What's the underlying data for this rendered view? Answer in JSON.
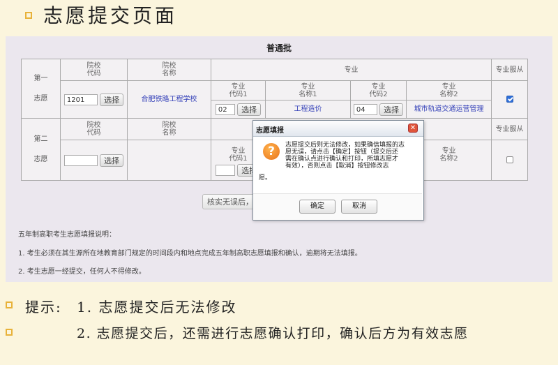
{
  "slide": {
    "title": "志愿提交页面",
    "tip_label": "提示:",
    "tip_1": "1. 志愿提交后无法修改",
    "tip_2": "2. 志愿提交后，还需进行志愿确认打印，确认后方为有效志愿"
  },
  "form": {
    "batch_title": "普通批",
    "choice1": {
      "label_top": "第一",
      "label_bottom": "志愿",
      "school_code_header": "院校\n代码",
      "school_name_header": "院校\n名称",
      "major_header": "专业",
      "obey_header": "专业服从",
      "school_code_value": "1201",
      "select_label": "选择",
      "school_name": "合肥铁路工程学校",
      "major1_code_header": "专业\n代码1",
      "major1_name_header": "专业\n名称1",
      "major2_code_header": "专业\n代码2",
      "major2_name_header": "专业\n名称2",
      "major1_code_value": "02",
      "major1_name": "工程造价",
      "major2_code_value": "04",
      "major2_name": "城市轨道交通运营管理",
      "obey_checked": true
    },
    "choice2": {
      "label_top": "第二",
      "label_bottom": "志愿",
      "school_code_header": "院校\n代码",
      "school_name_header": "院校\n名称",
      "obey_header": "专业服从",
      "select_label": "选择",
      "major1_code_header": "专业\n代码1",
      "major2_name_header": "专业\n名称2",
      "major_select_label": "选择",
      "obey_checked": false
    },
    "submit_partial": "核实无误后，i",
    "notes_title": "五年制高职考生志愿填报说明：",
    "note_1": "1. 考生必须在其生源所在地教育部门规定的时间段内和地点完成五年制高职志愿填报和确认，逾期将无法填报。",
    "note_2": "2. 考生志愿一经提交，任何人不得修改。"
  },
  "dialog": {
    "title": "志愿填报",
    "close_icon": "close-icon",
    "question_icon": "question-icon",
    "question_mark": "?",
    "message_line1": "志愿提交后则无法修改，如果确信填报的志",
    "message_line2": "愿无误，请点击【确定】按钮（提交后还",
    "message_line3": "需在确认点进行确认和打印，所填志愿才",
    "message_line4": "有效），否则点击【取消】按钮修改志",
    "message_line5": "愿。",
    "confirm_label": "确定",
    "cancel_label": "取消"
  },
  "colors": {
    "background": "#fbf5dd",
    "bullet": "#e8b23a",
    "panel": "#ebe7ee",
    "link": "#3340b8",
    "dialog_close": "#e0553a",
    "question_icon": "#e8731a"
  }
}
